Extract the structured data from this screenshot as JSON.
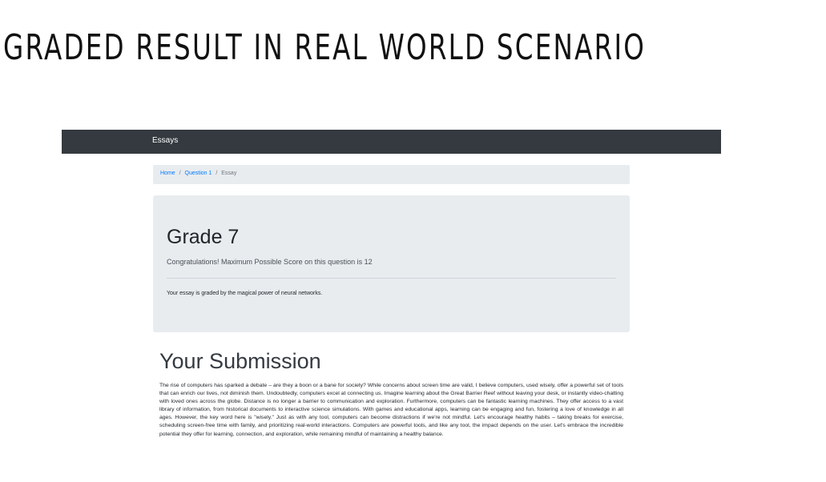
{
  "slide": {
    "title": "GRADED RESULT IN REAL WORLD SCENARIO"
  },
  "navbar": {
    "brand": "Essays",
    "background": "#343a40"
  },
  "breadcrumb": {
    "home": "Home",
    "separator": "/",
    "question": "Question 1",
    "current": "Essay"
  },
  "result": {
    "grade": "Grade 7",
    "message": "Congratulations! Maximum Possible Score on this question is 12",
    "note": "Your essay is graded by the magical power of neural networks."
  },
  "submission": {
    "heading": "Your Submission",
    "text": "The rise of computers has sparked a debate – are they a boon or a bane for society? While concerns about screen time are valid, I believe computers, used wisely, offer a powerful set of tools that can enrich our lives, not diminish them. Undoubtedly, computers excel at connecting us. Imagine learning about the Great Barrier Reef without leaving your desk, or instantly video-chatting with loved ones across the globe. Distance is no longer a barrier to communication and exploration. Furthermore, computers can be fantastic learning machines. They offer access to a vast library of information, from historical documents to interactive science simulations. With games and educational apps, learning can be engaging and fun, fostering a love of knowledge in all ages. However, the key word here is \"wisely.\" Just as with any tool, computers can become distractions if we're not mindful. Let's encourage healthy habits – taking breaks for exercise, scheduling screen-free time with family, and prioritizing real-world interactions. Computers are powerful tools, and like any tool, the impact depends on the user. Let's embrace the incredible potential they offer for learning, connection, and exploration, while remaining mindful of maintaining a healthy balance."
  }
}
